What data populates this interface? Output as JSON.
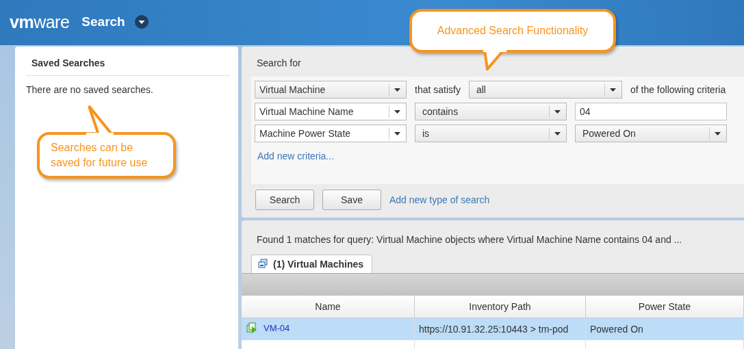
{
  "header": {
    "logo": "**vm**ware",
    "title": "Search"
  },
  "saved_searches": {
    "title": "Saved Searches",
    "empty_text": "There are no saved searches."
  },
  "search_form": {
    "label": "Search for",
    "object_type": "Virtual Machine",
    "satisfy_label": "that satisfy",
    "match_mode": "all",
    "criteria_suffix": "of the following criteria",
    "criteria": [
      {
        "field": "Virtual Machine Name",
        "operator": "contains",
        "value": "04",
        "kind": "text"
      },
      {
        "field": "Machine Power State",
        "operator": "is",
        "value": "Powered On",
        "kind": "select"
      }
    ],
    "add_criteria_link": "Add new criteria...",
    "buttons": [
      "Search",
      "Save"
    ],
    "add_type_link": "Add new type of search"
  },
  "results": {
    "summary": "Found 1 matches for query: Virtual Machine objects where Virtual Machine Name contains 04 and ...",
    "tabs": [
      {
        "label": "(1) Virtual Machines",
        "selected": true
      }
    ],
    "table": {
      "columns": [
        "Name",
        "Inventory Path",
        "Power State"
      ],
      "rows": [
        {
          "name": "VM-04",
          "path": "https://10.91.32.25:10443 > tm-pod",
          "state": "Powered On",
          "selected": true
        }
      ]
    }
  },
  "callouts": [
    {
      "text": "Advanced Search Functionality",
      "kind": "down"
    },
    {
      "text": "Searches can be saved for future use",
      "kind": "up"
    }
  ]
}
